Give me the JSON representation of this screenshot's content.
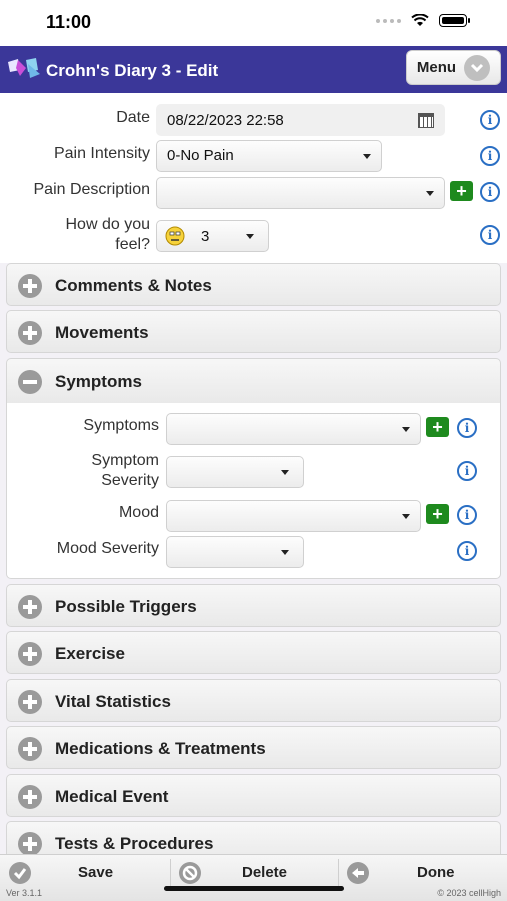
{
  "status_bar": {
    "time": "11:00"
  },
  "header": {
    "title": "Crohn's Diary 3 - Edit",
    "menu_label": "Menu"
  },
  "form": {
    "date_label": "Date",
    "date_value": "08/22/2023 22:58",
    "pain_intensity_label": "Pain Intensity",
    "pain_intensity_value": "0-No Pain",
    "pain_description_label": "Pain Description",
    "pain_description_value": "",
    "feel_label_line1": "How do you",
    "feel_label_line2": "feel?",
    "feel_value": "3"
  },
  "sections": {
    "comments": "Comments & Notes",
    "movements": "Movements",
    "symptoms": "Symptoms",
    "possible_triggers": "Possible Triggers",
    "exercise": "Exercise",
    "vital_statistics": "Vital Statistics",
    "medications": "Medications & Treatments",
    "medical_event": "Medical Event",
    "tests": "Tests & Procedures"
  },
  "symptoms_panel": {
    "symptoms_label": "Symptoms",
    "symptom_severity_line1": "Symptom",
    "symptom_severity_line2": "Severity",
    "mood_label": "Mood",
    "mood_severity_label": "Mood Severity"
  },
  "toolbar": {
    "save": "Save",
    "delete": "Delete",
    "done": "Done",
    "version": "Ver 3.1.1",
    "copyright": "© 2023 cellHigh"
  },
  "colors": {
    "header_bg": "#3b3799",
    "add_green": "#1e8a1e",
    "info_blue": "#2a6fc4"
  }
}
